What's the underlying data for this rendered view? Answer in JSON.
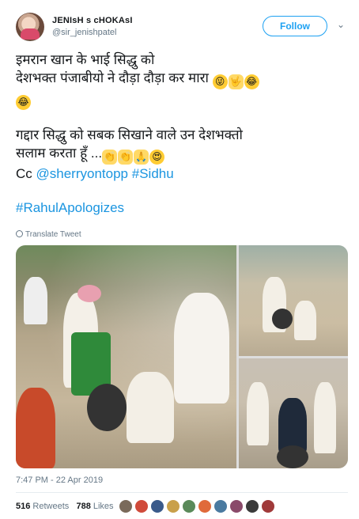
{
  "author": {
    "display_name": "JENIsH s cHOKAsI",
    "handle": "@sir_jenishpatel"
  },
  "follow_label": "Follow",
  "tweet": {
    "line1": "इमरान खान के भाई सिद्धु को",
    "line2": "देशभक्त पंजाबीयो ने दौड़ा दौड़ा कर मारा",
    "line3": "गद्दार सिद्धु को सबक सिखाने वाले उन देशभक्तो",
    "line4": "सलाम करता हूँ ...",
    "cc_prefix": "Cc",
    "mention": "@sherryontopp",
    "hashtag1": "#Sidhu",
    "hashtag2": "#RahulApologizes",
    "emojis": {
      "line2": [
        "😜",
        "🤟",
        "😂"
      ],
      "line2b": [
        "😂"
      ],
      "line4": [
        "👏",
        "👏",
        "🙏",
        "😍"
      ]
    }
  },
  "translate_label": "Translate Tweet",
  "timestamp": "7:47 PM - 22 Apr 2019",
  "stats": {
    "retweets_count": "516",
    "retweets_label": "Retweets",
    "likes_count": "788",
    "likes_label": "Likes"
  },
  "liker_colors": [
    "#7a6a5a",
    "#d04a3a",
    "#3a5a8a",
    "#c9a04a",
    "#5a8a5a",
    "#e06a3a",
    "#4a7aa0",
    "#8a4a6a",
    "#3a3a3a",
    "#a03a3a"
  ],
  "colors": {
    "accent": "#1da1f2",
    "link": "#1b95e0",
    "muted": "#657786"
  }
}
